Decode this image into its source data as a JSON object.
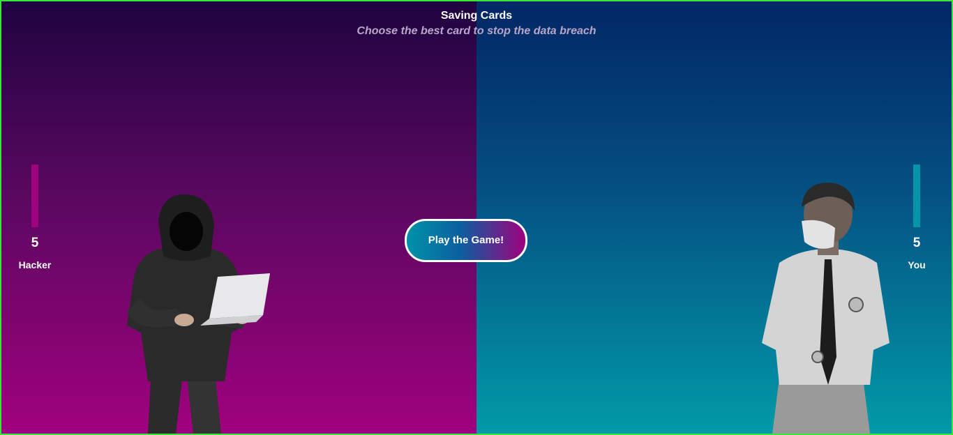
{
  "header": {
    "title": "Saving Cards",
    "subtitle": "Choose the best card to stop the data breach"
  },
  "hacker": {
    "score": "5",
    "label": "Hacker",
    "color": "#a0017e"
  },
  "player": {
    "score": "5",
    "label": "You",
    "color": "#0496a8"
  },
  "play_button": {
    "label": "Play the Game!"
  },
  "theme": {
    "left_top": "#1f0440",
    "left_bottom": "#a0017e",
    "right_top": "#022765",
    "right_bottom": "#029aa8",
    "frame": "#39e639"
  }
}
